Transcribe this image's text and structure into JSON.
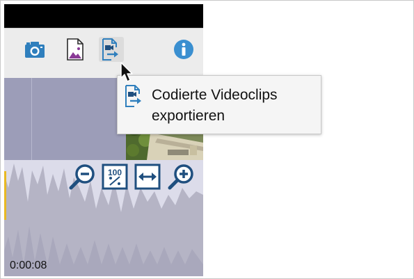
{
  "toolbar": {
    "buttons": [
      {
        "icon": "camera-icon"
      },
      {
        "icon": "image-export-icon"
      },
      {
        "icon": "export-video-clips-icon",
        "active": true
      },
      {
        "icon": "info-icon"
      }
    ]
  },
  "tooltip": {
    "text": "Codierte Videoclips exportieren",
    "icon": "export-video-clips-icon"
  },
  "timeline": {
    "timecode": "0:00:08",
    "zoom_controls": [
      "zoom-out-icon",
      "zoom-100-percent-icon",
      "zoom-fit-icon",
      "zoom-in-icon"
    ],
    "zoom_100_label": "100"
  },
  "colors": {
    "icon_blue": "#2f7fbd",
    "dark_blue": "#1f4f7f",
    "purple": "#8a3a96",
    "clip_track": "#9c9db8",
    "waveform_bg": "#dcdcea",
    "waveform": "#b5b4c5"
  }
}
